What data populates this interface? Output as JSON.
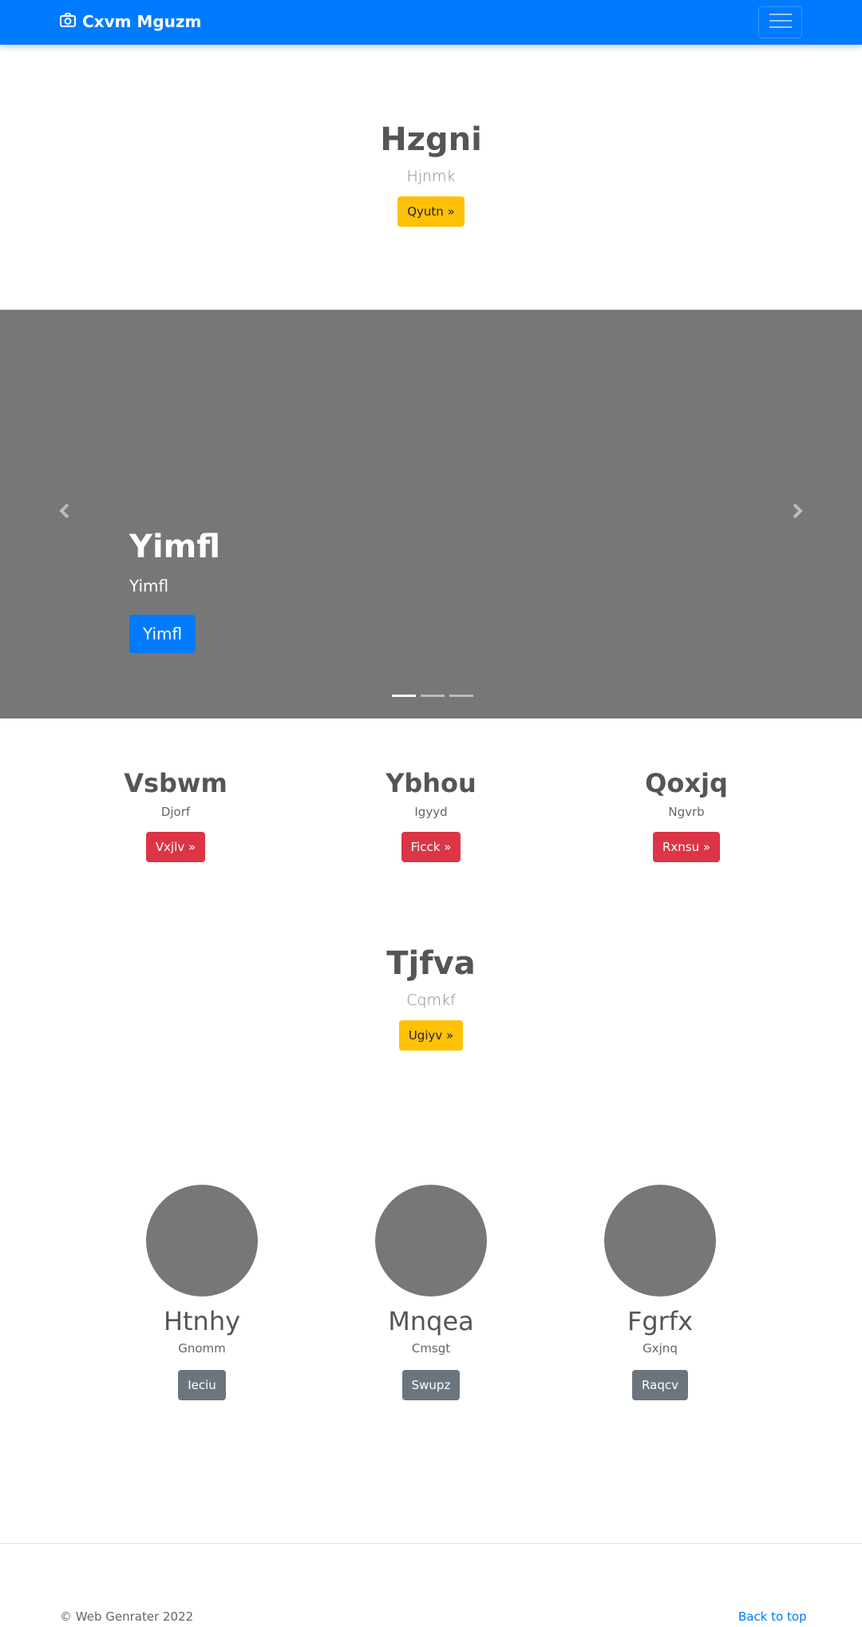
{
  "navbar": {
    "brand": "Cxvm Mguzm",
    "brand_icon": "camera-icon",
    "toggler_icon": "hamburger-icon",
    "color": "#007bff"
  },
  "hero": {
    "title": "Hzgni",
    "subtitle": "Hjnmk",
    "button": "Qyutn »"
  },
  "carousel": {
    "caption_title": "Yimfl",
    "caption_text": "Yimfl",
    "caption_button": "Yimfl",
    "prev_icon": "chevron-left-icon",
    "next_icon": "chevron-right-icon",
    "slides": 3,
    "active_index": 0
  },
  "features": [
    {
      "title": "Vsbwm",
      "text": "Djorf",
      "button": "Vxjlv »"
    },
    {
      "title": "Ybhou",
      "text": "Igyyd",
      "button": "Ficck »"
    },
    {
      "title": "Qoxjq",
      "text": "Ngvrb",
      "button": "Rxnsu »"
    }
  ],
  "section2": {
    "title": "Tjfva",
    "subtitle": "Cqmkf",
    "button": "Ugiyv »"
  },
  "people": [
    {
      "name": "Htnhy",
      "text": "Gnomm",
      "button": "Ieciu"
    },
    {
      "name": "Mnqea",
      "text": "Cmsgt",
      "button": "Swupz"
    },
    {
      "name": "Fgrfx",
      "text": "Gxjnq",
      "button": "Raqcv"
    }
  ],
  "footer": {
    "copyright": "© Web Genrater 2022",
    "back_to_top": "Back to top"
  }
}
